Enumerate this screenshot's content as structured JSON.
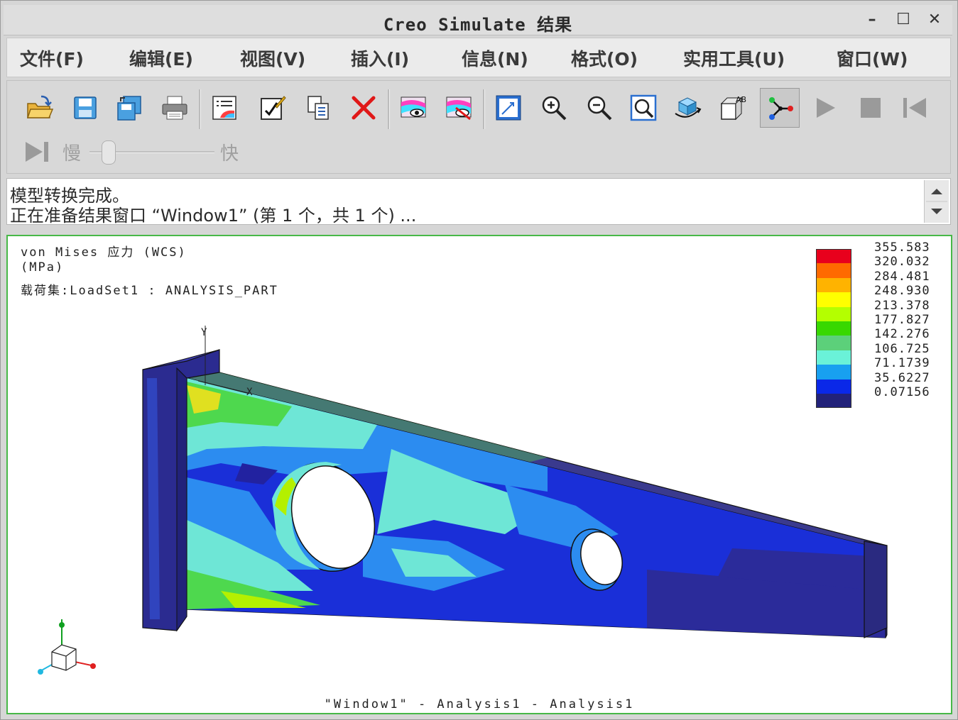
{
  "window": {
    "title": "Creo Simulate 结果",
    "minimize_glyph": "–",
    "maximize_glyph": "☐",
    "close_glyph": "✕"
  },
  "menu": [
    {
      "label": "文件(F)"
    },
    {
      "label": "编辑(E)"
    },
    {
      "label": "视图(V)"
    },
    {
      "label": "插入(I)"
    },
    {
      "label": "信息(N)"
    },
    {
      "label": "格式(O)"
    },
    {
      "label": "实用工具(U)"
    },
    {
      "label": "窗口(W)"
    }
  ],
  "toolbar": {
    "icons": [
      "open-icon",
      "save-icon",
      "save-copy-icon",
      "print-icon",
      "result-window-icon",
      "edit-definition-icon",
      "copy-icon",
      "delete-icon",
      "show-result-icon",
      "hide-result-icon",
      "refit-icon",
      "zoom-in-icon",
      "zoom-out-icon",
      "zoom-window-icon",
      "spin-icon",
      "label-icon",
      "model-tree-icon",
      "play-icon",
      "stop-icon",
      "rewind-icon"
    ],
    "speed_slow": "慢",
    "speed_fast": "快",
    "speed_level": 0.15
  },
  "messages": [
    "模型转换完成。",
    "正在准备结果窗口 “Window1” (第 1 个，共 1 个) ..."
  ],
  "viewport": {
    "info_line1": "von Mises 应力 (WCS)",
    "info_line2": "(MPa)",
    "info_line3": "载荷集:LoadSet1  :   ANALYSIS_PART",
    "footer": "\"Window1\" - Analysis1 - Analysis1",
    "axis_y": "Y",
    "axis_x": "X"
  },
  "legend": {
    "values": [
      "355.583",
      "320.032",
      "284.481",
      "248.930",
      "213.378",
      "177.827",
      "142.276",
      "106.725",
      "71.1739",
      "35.6227",
      "0.07156"
    ],
    "colors": [
      "#e8001c",
      "#ff6a00",
      "#ffb300",
      "#ffff00",
      "#b4ff00",
      "#38d800",
      "#5cd07a",
      "#6af2d8",
      "#18a0f0",
      "#0a28e8",
      "#22227a"
    ]
  }
}
